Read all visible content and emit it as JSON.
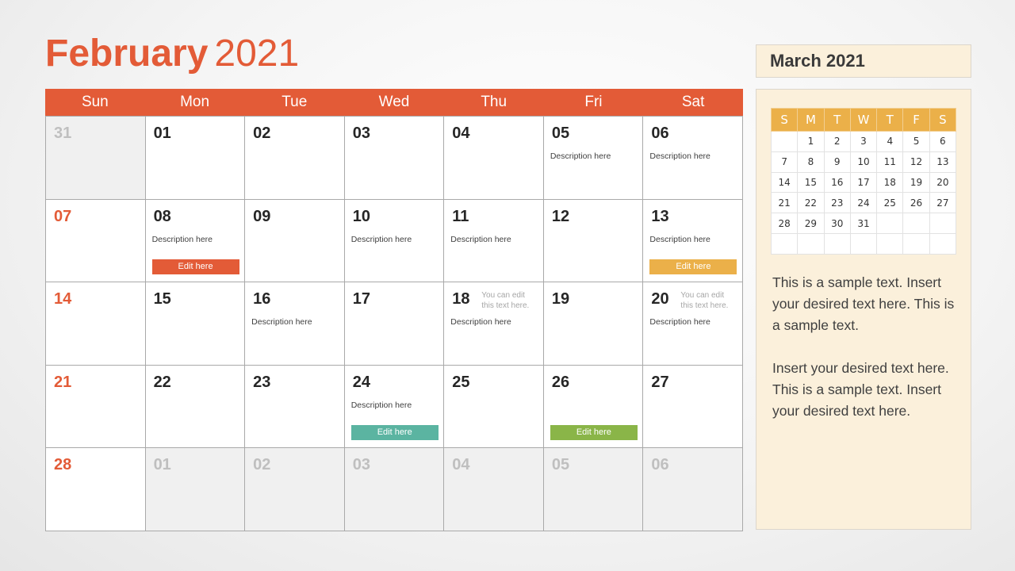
{
  "header": {
    "month": "February",
    "year": "2021"
  },
  "colors": {
    "accent": "#e35b37",
    "yellow": "#ebb049",
    "teal": "#5bb4a1",
    "green": "#8ab548",
    "panel": "#fbf0db"
  },
  "weekdays": [
    "Sun",
    "Mon",
    "Tue",
    "Wed",
    "Thu",
    "Fri",
    "Sat"
  ],
  "weeks": [
    [
      {
        "day": "31",
        "other": true
      },
      {
        "day": "01"
      },
      {
        "day": "02"
      },
      {
        "day": "03"
      },
      {
        "day": "04"
      },
      {
        "day": "05",
        "desc": "Description here"
      },
      {
        "day": "06",
        "desc": "Description here"
      }
    ],
    [
      {
        "day": "07",
        "sunday": true
      },
      {
        "day": "08",
        "desc": "Description here",
        "button": "Edit here",
        "button_color": "#e35b37"
      },
      {
        "day": "09"
      },
      {
        "day": "10",
        "desc": "Description here"
      },
      {
        "day": "11",
        "desc": "Description here"
      },
      {
        "day": "12"
      },
      {
        "day": "13",
        "desc": "Description here",
        "button": "Edit here",
        "button_color": "#ebb049"
      }
    ],
    [
      {
        "day": "14",
        "sunday": true
      },
      {
        "day": "15"
      },
      {
        "day": "16",
        "desc": "Description here"
      },
      {
        "day": "17"
      },
      {
        "day": "18",
        "desc": "Description here",
        "note": "You can edit this text here."
      },
      {
        "day": "19"
      },
      {
        "day": "20",
        "desc": "Description here",
        "note": "You can edit this text here."
      }
    ],
    [
      {
        "day": "21",
        "sunday": true
      },
      {
        "day": "22"
      },
      {
        "day": "23"
      },
      {
        "day": "24",
        "desc": "Description here",
        "button": "Edit here",
        "button_color": "#5bb4a1"
      },
      {
        "day": "25"
      },
      {
        "day": "26",
        "button": "Edit here",
        "button_color": "#8ab548"
      },
      {
        "day": "27"
      }
    ],
    [
      {
        "day": "28",
        "sunday": true
      },
      {
        "day": "01",
        "other": true
      },
      {
        "day": "02",
        "other": true
      },
      {
        "day": "03",
        "other": true
      },
      {
        "day": "04",
        "other": true
      },
      {
        "day": "05",
        "other": true
      },
      {
        "day": "06",
        "other": true
      }
    ]
  ],
  "sidebar": {
    "title": "March 2021",
    "mini_weekdays": [
      "S",
      "M",
      "T",
      "W",
      "T",
      "F",
      "S"
    ],
    "mini_weeks": [
      [
        "",
        "1",
        "2",
        "3",
        "4",
        "5",
        "6"
      ],
      [
        "7",
        "8",
        "9",
        "10",
        "11",
        "12",
        "13"
      ],
      [
        "14",
        "15",
        "16",
        "17",
        "18",
        "19",
        "20"
      ],
      [
        "21",
        "22",
        "23",
        "24",
        "25",
        "26",
        "27"
      ],
      [
        "28",
        "29",
        "30",
        "31",
        "",
        "",
        ""
      ],
      [
        "",
        "",
        "",
        "",
        "",
        "",
        ""
      ]
    ],
    "paragraphs": [
      "This is a sample text. Insert your desired text here. This is a sample text.",
      "Insert your desired text here. This is a sample text. Insert your desired text here."
    ]
  }
}
